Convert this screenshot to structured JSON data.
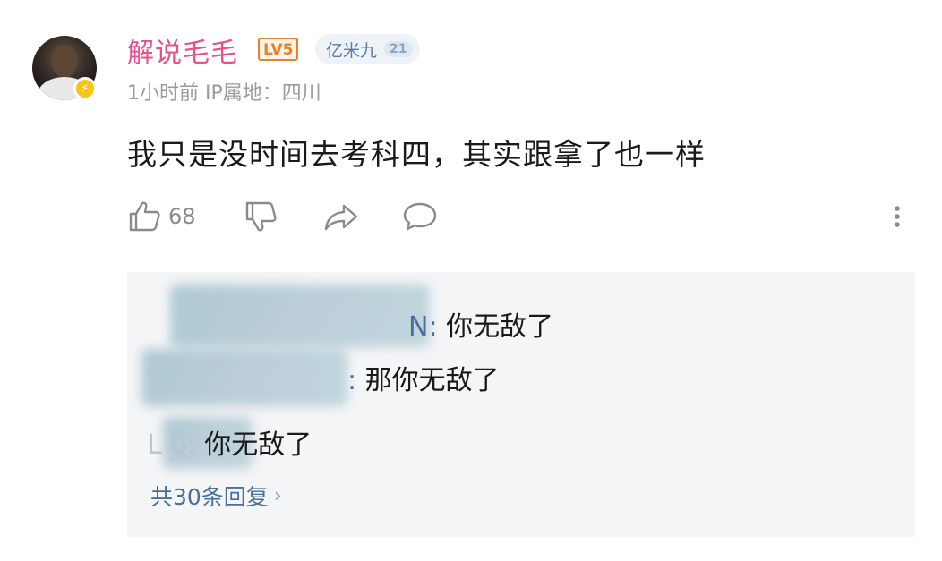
{
  "comment": {
    "username": "解说毛毛",
    "level_badge": "LV5",
    "fan_badge": {
      "name": "亿米九",
      "level": "21"
    },
    "meta": "1小时前 IP属地：四川",
    "text": "我只是没时间去考科四，其实跟拿了也一样",
    "like_count": "68"
  },
  "replies": {
    "items": [
      {
        "name_fragment": "N:",
        "text": "你无敌了"
      },
      {
        "name_fragment": ":",
        "text": "那你无敌了"
      },
      {
        "name_fragment": "L    o:",
        "text": "你无敌了"
      }
    ],
    "view_all": "共30条回复",
    "view_all_chevron": "›"
  },
  "icons": {
    "like": "thumbs-up-icon",
    "dislike": "thumbs-down-icon",
    "share": "share-arrow-icon",
    "reply": "comment-bubble-icon",
    "more": "more-vertical-icon",
    "vip": "lightning-badge-icon"
  },
  "colors": {
    "username": "#e8528c",
    "level_badge": "#e8822a",
    "reply_name": "#4b6f97",
    "reply_bg": "#f4f5f7"
  }
}
